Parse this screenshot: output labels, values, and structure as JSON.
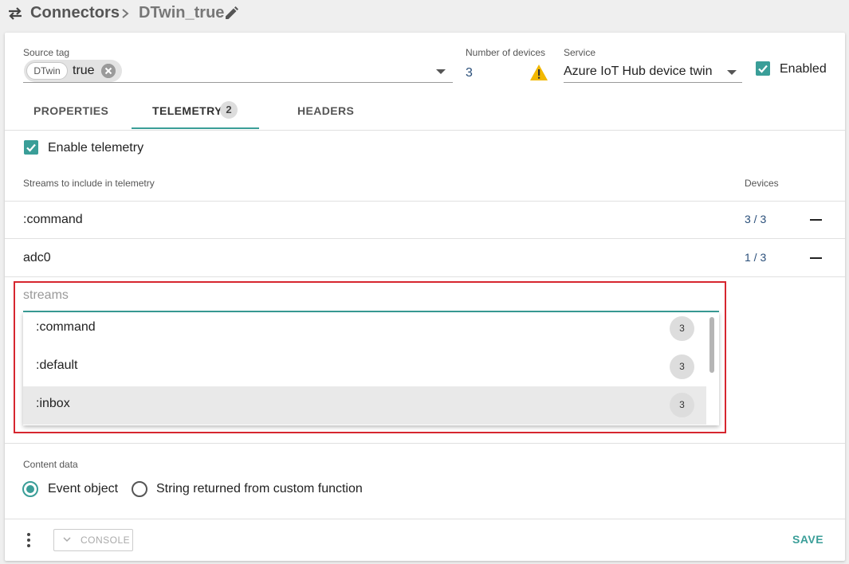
{
  "header": {
    "title": "Connectors",
    "subtitle": "DTwin_true"
  },
  "source_tag": {
    "label": "Source tag",
    "chip_key": "DTwin",
    "chip_value": "true"
  },
  "number_of_devices": {
    "label": "Number of devices",
    "value": "3"
  },
  "service": {
    "label": "Service",
    "value": "Azure IoT Hub device twin"
  },
  "enabled": {
    "label": "Enabled",
    "checked": true
  },
  "tabs": [
    {
      "label": "PROPERTIES",
      "active": false
    },
    {
      "label": "TELEMETRY",
      "badge": "2",
      "active": true
    },
    {
      "label": "HEADERS",
      "active": false
    }
  ],
  "telemetry": {
    "enable_label": "Enable telemetry",
    "enabled": true,
    "streams_header": "Streams to include in telemetry",
    "devices_header": "Devices",
    "rows": [
      {
        "name": ":command",
        "devices": "3 / 3"
      },
      {
        "name": "adc0",
        "devices": "1 / 3"
      }
    ],
    "streams_placeholder": "streams",
    "options": [
      {
        "name": ":command",
        "count": "3"
      },
      {
        "name": ":default",
        "count": "3"
      },
      {
        "name": ":inbox",
        "count": "3",
        "highlighted": true
      }
    ]
  },
  "content_data": {
    "label": "Content data",
    "options": [
      {
        "label": "Event object",
        "selected": true
      },
      {
        "label": "String returned from custom function",
        "selected": false
      }
    ]
  },
  "footer": {
    "console_label": "CONSOLE",
    "save_label": "SAVE"
  },
  "colors": {
    "accent": "#3a9e98",
    "link_value": "#2a4f7a",
    "highlight_border": "#d6262f",
    "warning": "#f2b800"
  }
}
